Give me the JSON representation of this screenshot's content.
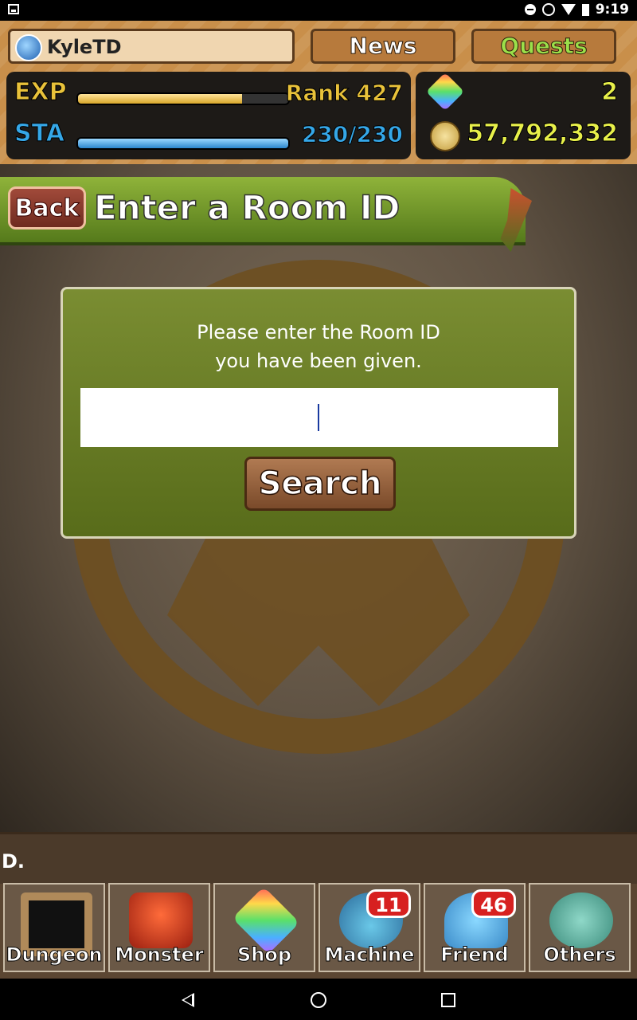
{
  "status_bar": {
    "time": "9:19"
  },
  "header": {
    "player_name": "KyleTD",
    "news_label": "News",
    "quests_label": "Quests",
    "exp_label": "EXP",
    "rank_text": "Rank 427",
    "exp_progress": 0.78,
    "sta_label": "STA",
    "sta_text": "230/230",
    "sta_progress": 1.0,
    "magic_stones": "2",
    "coins": "57,792,332"
  },
  "page": {
    "back_label": "Back",
    "title": "Enter a Room ID"
  },
  "dialog": {
    "prompt_line1": "Please enter the Room ID",
    "prompt_line2": "you have been given.",
    "input_value": "",
    "search_label": "Search"
  },
  "ticker": {
    "text": "D."
  },
  "nav": {
    "items": [
      {
        "label": "Dungeon",
        "badge": ""
      },
      {
        "label": "Monster",
        "badge": ""
      },
      {
        "label": "Shop",
        "badge": ""
      },
      {
        "label": "Machine",
        "badge": "11"
      },
      {
        "label": "Friend",
        "badge": "46"
      },
      {
        "label": "Others",
        "badge": ""
      }
    ]
  },
  "colors": {
    "accent_green": "#7a8d32",
    "exp_color": "#e9c23a",
    "sta_color": "#35a7e8",
    "badge_red": "#d72020"
  }
}
